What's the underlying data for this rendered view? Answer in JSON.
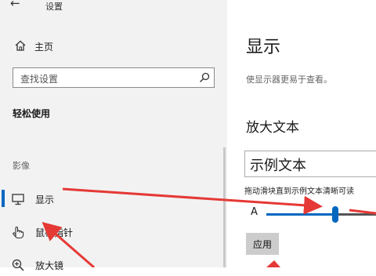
{
  "window": {
    "title": "设置"
  },
  "sidebar": {
    "home_label": "主页",
    "search_placeholder": "查找设置",
    "category": "轻松使用",
    "section": "影像",
    "items": [
      {
        "label": "显示",
        "icon": "monitor-icon",
        "active": true
      },
      {
        "label": "鼠标指针",
        "icon": "mouse-pointer-icon",
        "active": false
      },
      {
        "label": "放大镜",
        "icon": "magnifier-icon",
        "active": false
      }
    ]
  },
  "main": {
    "title": "显示",
    "description": "使显示器更易于查看。",
    "section_title": "放大文本",
    "sample_text": "示例文本",
    "instruction": "拖动滑块直到示例文本清晰可读",
    "slider_letter": "A",
    "slider_level": 0.63,
    "apply_label": "应用"
  },
  "colors": {
    "accent": "#0067c0",
    "annotation": "#e53935",
    "sidebar_bg": "#f2f2f2"
  }
}
